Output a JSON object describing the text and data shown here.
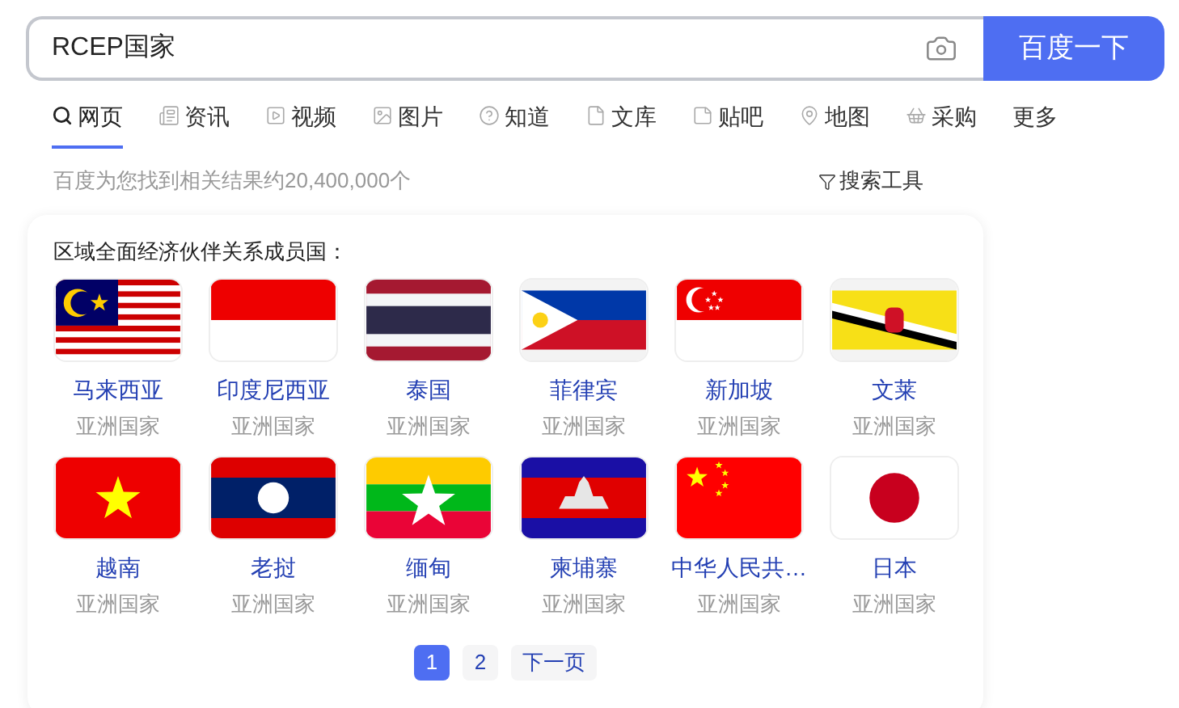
{
  "search": {
    "value": "RCEP国家",
    "button": "百度一下"
  },
  "tabs": [
    {
      "label": "网页",
      "selected": true,
      "kind": "search"
    },
    {
      "label": "资讯",
      "selected": false,
      "kind": "news"
    },
    {
      "label": "视频",
      "selected": false,
      "kind": "video"
    },
    {
      "label": "图片",
      "selected": false,
      "kind": "image"
    },
    {
      "label": "知道",
      "selected": false,
      "kind": "question"
    },
    {
      "label": "文库",
      "selected": false,
      "kind": "doc"
    },
    {
      "label": "贴吧",
      "selected": false,
      "kind": "forum"
    },
    {
      "label": "地图",
      "selected": false,
      "kind": "map"
    },
    {
      "label": "采购",
      "selected": false,
      "kind": "basket"
    },
    {
      "label": "更多",
      "selected": false,
      "kind": "more"
    }
  ],
  "result_count": "百度为您找到相关结果约20,400,000个",
  "search_tools": "搜索工具",
  "card": {
    "title": "区域全面经济伙伴关系成员国：",
    "items": [
      {
        "name": "马来西亚",
        "sub": "亚洲国家",
        "kind": "malaysia"
      },
      {
        "name": "印度尼西亚",
        "sub": "亚洲国家",
        "kind": "indonesia"
      },
      {
        "name": "泰国",
        "sub": "亚洲国家",
        "kind": "thailand"
      },
      {
        "name": "菲律宾",
        "sub": "亚洲国家",
        "kind": "philippines"
      },
      {
        "name": "新加坡",
        "sub": "亚洲国家",
        "kind": "singapore"
      },
      {
        "name": "文莱",
        "sub": "亚洲国家",
        "kind": "brunei"
      },
      {
        "name": "越南",
        "sub": "亚洲国家",
        "kind": "vietnam"
      },
      {
        "name": "老挝",
        "sub": "亚洲国家",
        "kind": "laos"
      },
      {
        "name": "缅甸",
        "sub": "亚洲国家",
        "kind": "myanmar"
      },
      {
        "name": "柬埔寨",
        "sub": "亚洲国家",
        "kind": "cambodia"
      },
      {
        "name": "中华人民共…",
        "sub": "亚洲国家",
        "kind": "china"
      },
      {
        "name": "日本",
        "sub": "亚洲国家",
        "kind": "japan"
      }
    ],
    "pages": [
      {
        "label": "1",
        "selected": true
      },
      {
        "label": "2",
        "selected": false
      },
      {
        "label": "下一页",
        "selected": false
      }
    ]
  }
}
